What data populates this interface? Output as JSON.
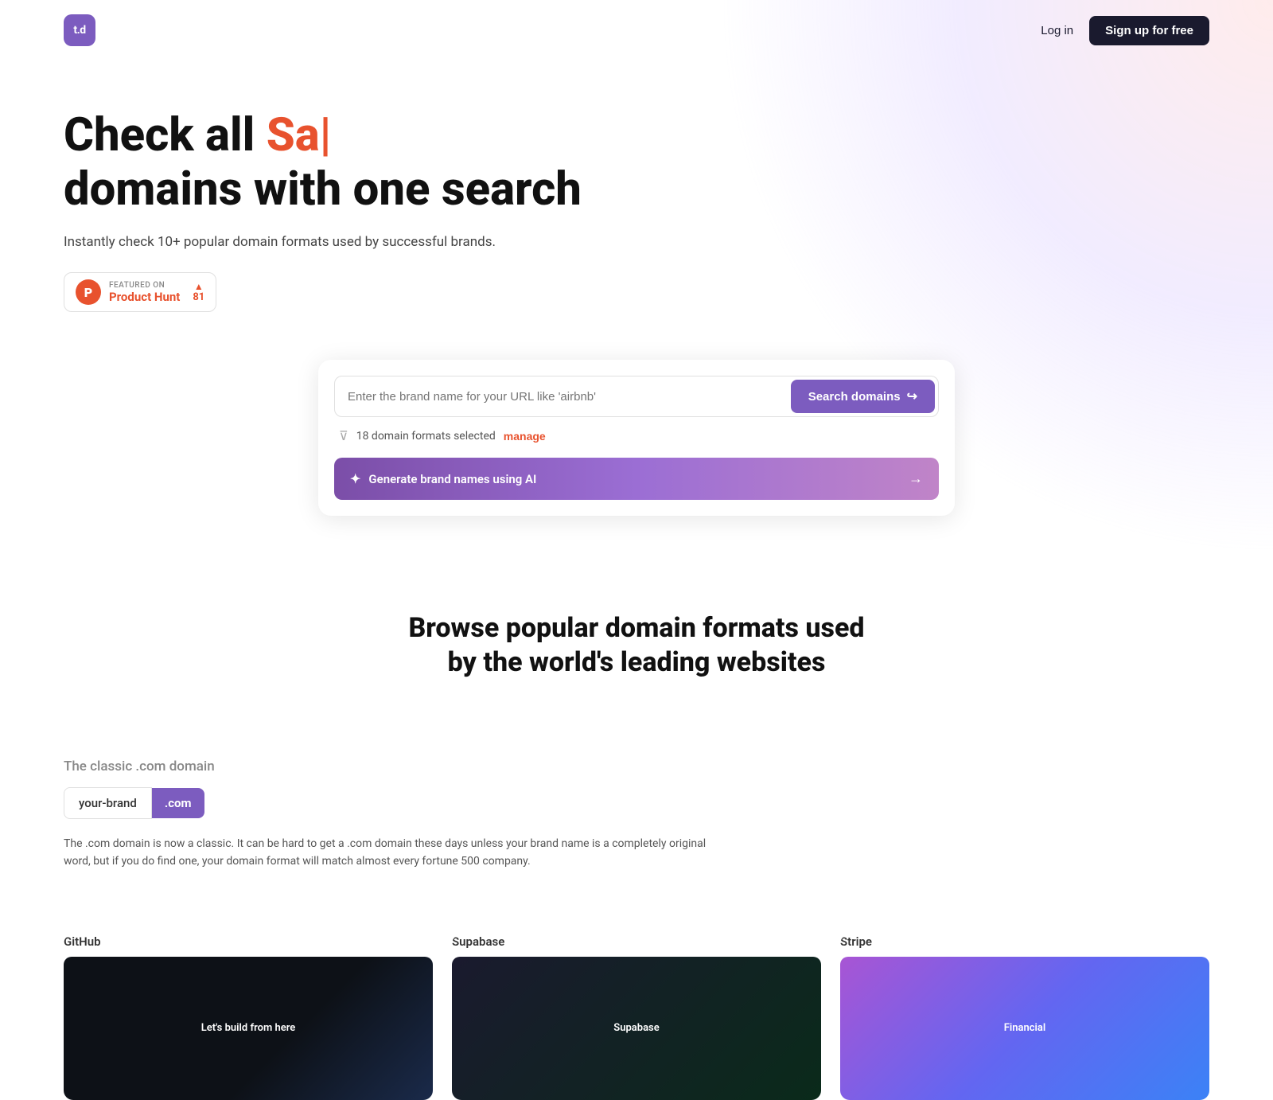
{
  "brand": {
    "logo_text": "t.d",
    "logo_bg": "#7c5cbf"
  },
  "nav": {
    "login_label": "Log in",
    "signup_label": "Sign up for free"
  },
  "hero": {
    "title_prefix": "Check all ",
    "title_highlight": "Sa|",
    "title_line2": "domains with one search",
    "subtitle": "Instantly check 10+ popular domain formats used by successful brands.",
    "product_hunt": {
      "featured_on": "FEATURED ON",
      "name": "Product Hunt",
      "count": "81"
    }
  },
  "search": {
    "placeholder": "Enter the brand name for your URL like 'airbnb'",
    "button_label": "Search domains",
    "filter_text": "18 domain formats selected",
    "manage_label": "manage",
    "ai_label": "Generate brand names using AI"
  },
  "browse": {
    "title": "Browse popular domain formats used by the world's leading websites"
  },
  "domain_classic": {
    "label": "The classic .com domain",
    "brand_part": "your-brand",
    "ext_part": ".com",
    "description": "The .com domain is now a classic. It can be hard to get a .com domain these days unless your brand name is a completely original word, but if you do find one, your domain format will match almost every fortune 500 company."
  },
  "companies": [
    {
      "name": "GitHub",
      "theme": "github",
      "preview_text": "Let's build from here"
    },
    {
      "name": "Supabase",
      "theme": "supabase",
      "preview_text": "Supabase"
    },
    {
      "name": "Stripe",
      "theme": "stripe",
      "preview_text": "Financial"
    }
  ]
}
